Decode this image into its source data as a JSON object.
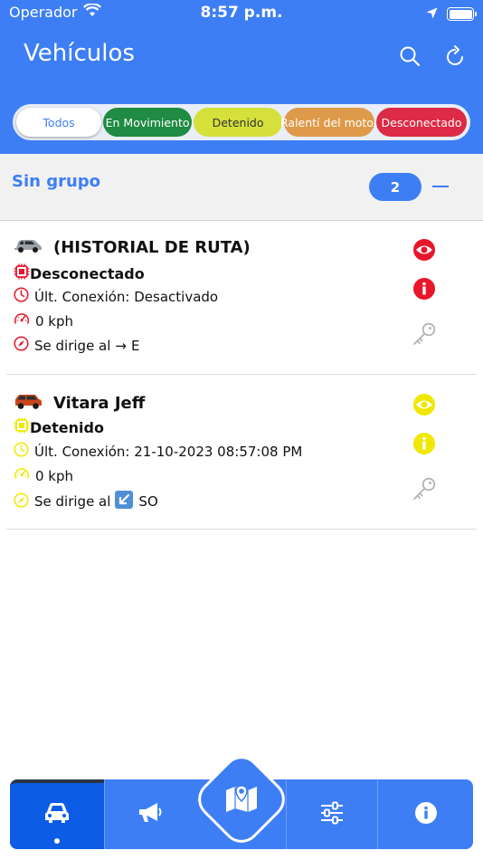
{
  "status_bar": {
    "carrier": "Operador",
    "time": "8:57 p.m."
  },
  "header": {
    "title": "Vehículos",
    "icons": [
      "search-icon",
      "refresh-icon"
    ]
  },
  "filters": [
    {
      "label": "Todos",
      "color": "#ffffff",
      "active": true
    },
    {
      "label": "En Movimiento",
      "color": "#1f8b43"
    },
    {
      "label": "Detenido",
      "color": "#d5e03a"
    },
    {
      "label": "Ralentí del motor",
      "color": "#de9a4a"
    },
    {
      "label": "Desconectado",
      "color": "#dd2a46"
    }
  ],
  "group": {
    "title": "Sin grupo",
    "count": "2"
  },
  "vehicles": [
    {
      "name": "(HISTORIAL DE RUTA)",
      "status": "Desconectado",
      "last_connection": "Últ. Conexión: Desactivado",
      "speed": "0 kph",
      "heading_prefix": "Se dirige al",
      "heading_symbol": "→",
      "heading_dir": "E",
      "status_color": "#e8152b",
      "icons": [
        "car-icon",
        "eye-icon",
        "info-icon",
        "key-icon"
      ]
    },
    {
      "name": "Vitara Jeff",
      "status": "Detenido",
      "last_connection": "Últ. Conexión: 21-10-2023 08:57:08 PM",
      "speed": "0 kph",
      "heading_prefix": "Se dirige al",
      "heading_symbol": "↙",
      "heading_dir": "SO",
      "status_color": "#f0e800",
      "icons": [
        "car-icon",
        "eye-icon",
        "info-icon",
        "key-icon"
      ]
    }
  ],
  "bottom_nav": {
    "items": [
      "car-icon",
      "megaphone-icon",
      "map-icon",
      "sliders-icon",
      "info-icon"
    ],
    "active": "car-icon",
    "accent": "#3d7ef5"
  }
}
